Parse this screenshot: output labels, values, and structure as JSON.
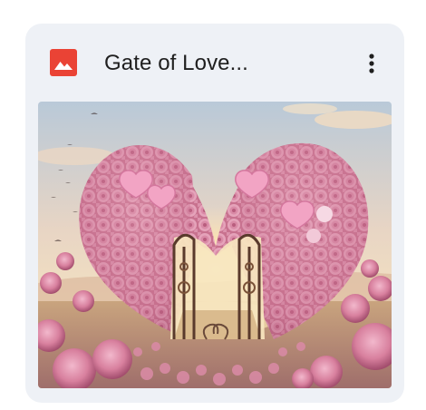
{
  "file_card": {
    "type_icon": "image-file-icon",
    "type_icon_color": "#ea4335",
    "title": "Gate of Love...",
    "menu_icon": "more-vert-icon",
    "thumbnail_subject": "heart-shaped-rose-arch-gate"
  },
  "colors": {
    "card_background": "#eef1f6",
    "title_text": "#1f1f1f"
  }
}
